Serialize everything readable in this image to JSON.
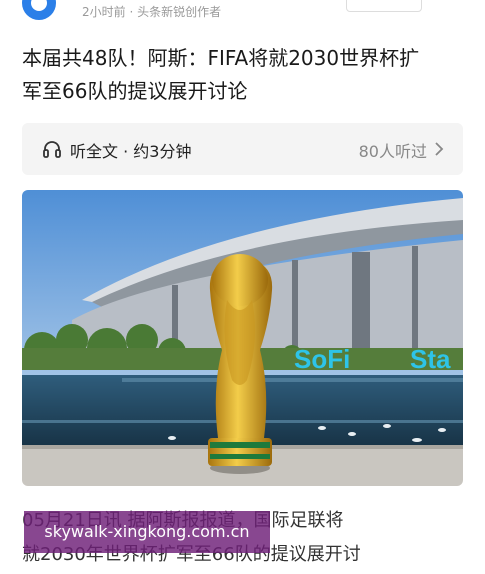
{
  "header": {
    "meta": "2小时前 · 头条新锐创作者"
  },
  "article": {
    "title_line1": "本届共48队！阿斯：FIFA将就2030世界杯扩",
    "title_line2": "军至66队的提议展开讨论"
  },
  "listen": {
    "label": "听全文 · 约3分钟",
    "count": "80人听过"
  },
  "photo": {
    "sign_text_a": "SoFi",
    "sign_text_b": "Sta"
  },
  "snippet": {
    "line1": "05月21日讯 据阿斯报报道，国际足联将",
    "line2": "就2030年世界杯扩军至66队的提议展开讨"
  },
  "watermark": {
    "text": "skywalk-xingkong.com.cn"
  },
  "colors": {
    "accent": "#2b7fe8",
    "watermark_bg": "#6e1e78",
    "sign": "#2ec4e8"
  },
  "icons": {
    "app": "app-logo-icon",
    "listen": "headphone-icon",
    "more": "chevron-right-icon"
  }
}
